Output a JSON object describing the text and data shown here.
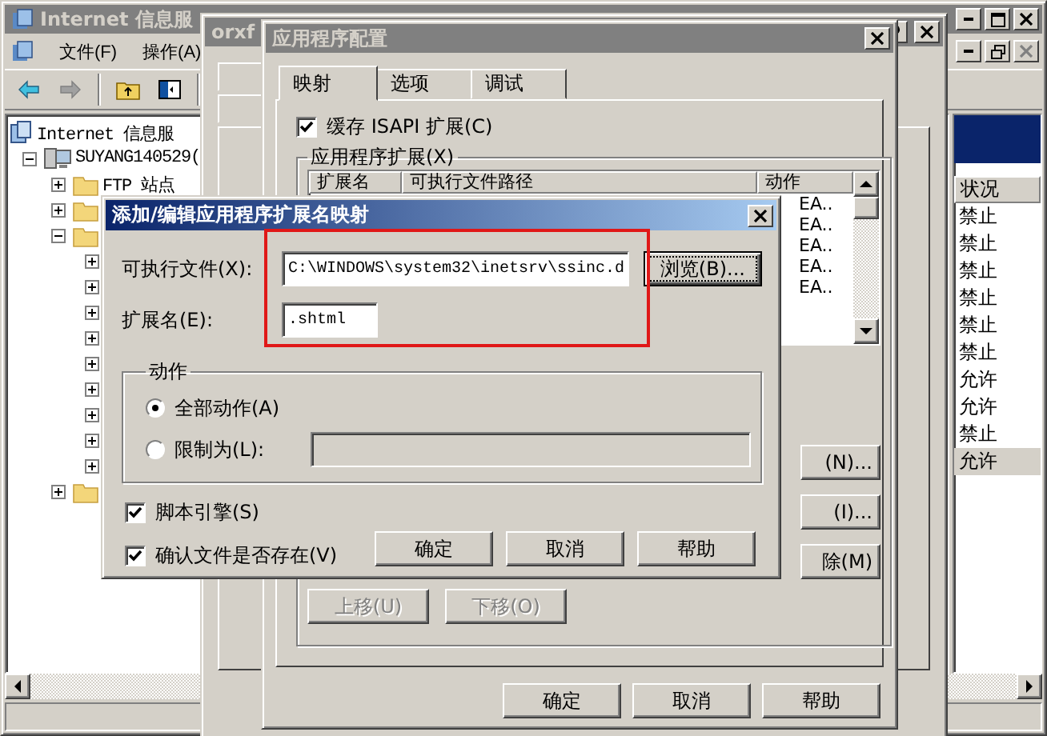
{
  "main_window": {
    "title": "Internet 信息服",
    "menu": [
      "文件(F)",
      "操作(A)"
    ],
    "toolbar": [
      {
        "kind": "back",
        "disabled": false
      },
      {
        "kind": "forward",
        "disabled": true
      },
      {
        "kind": "up",
        "disabled": false
      },
      {
        "kind": "tree",
        "disabled": false
      }
    ],
    "tree": [
      {
        "label": "Internet 信息服",
        "kind": "iis",
        "children": [
          {
            "label": "SUYANG140529(",
            "kind": "server",
            "expanded": true,
            "children": [
              {
                "label": "FTP 站点",
                "kind": "folder",
                "expanded": false
              },
              {
                "kind": "folder",
                "expanded": false
              },
              {
                "kind": "folder",
                "expanded": true,
                "children": [
                  {
                    "expanded": false
                  },
                  {
                    "expanded": false
                  },
                  {
                    "expanded": false
                  },
                  {
                    "expanded": false
                  },
                  {
                    "expanded": false
                  },
                  {
                    "expanded": false
                  },
                  {
                    "expanded": false
                  },
                  {
                    "expanded": false
                  },
                  {
                    "expanded": false
                  }
                ]
              },
              {
                "kind": "folder",
                "expanded": false
              }
            ]
          }
        ]
      }
    ],
    "status_column": {
      "header": "状况",
      "rows": [
        {
          "text": "禁止",
          "selected": false
        },
        {
          "text": "禁止",
          "selected": false
        },
        {
          "text": "禁止",
          "selected": false
        },
        {
          "text": "禁止",
          "selected": false
        },
        {
          "text": "禁止",
          "selected": false
        },
        {
          "text": "禁止",
          "selected": false
        },
        {
          "text": "允许",
          "selected": false
        },
        {
          "text": "允许",
          "selected": false
        },
        {
          "text": "禁止",
          "selected": false
        },
        {
          "text": "允许",
          "selected": true
        }
      ]
    }
  },
  "properties_dialog": {
    "title": "orxf"
  },
  "app_config_dialog": {
    "title": "应用程序配置",
    "tabs": [
      {
        "label": "映射",
        "selected": true
      },
      {
        "label": "选项",
        "selected": false
      },
      {
        "label": "调试",
        "selected": false
      }
    ],
    "cache_isapi": {
      "label": "缓存 ISAPI 扩展(C)",
      "checked": true
    },
    "extensions_group": {
      "label": "应用程序扩展(X)",
      "columns": [
        "扩展名",
        "可执行文件路径",
        "动作"
      ],
      "rows": [
        "EA..",
        "EA..",
        "EA..",
        "EA..",
        "EA.."
      ]
    },
    "side_buttons": [
      "(N)...",
      "(I)...",
      "除(M)"
    ],
    "move_buttons": [
      {
        "label": "上移(U)",
        "disabled": true
      },
      {
        "label": "下移(O)",
        "disabled": true
      }
    ],
    "buttons": [
      "确定",
      "取消",
      "帮助"
    ]
  },
  "mapping_dialog": {
    "title": "添加/编辑应用程序扩展名映射",
    "executable": {
      "label": "可执行文件(X):",
      "value": "C:\\WINDOWS\\system32\\inetsrv\\ssinc.d"
    },
    "browse_button": "浏览(B)...",
    "extension": {
      "label": "扩展名(E):",
      "value": ".shtml"
    },
    "verbs_group": {
      "label": "动作",
      "options": [
        {
          "label": "全部动作(A)",
          "selected": true
        },
        {
          "label": "限制为(L):",
          "selected": false
        }
      ]
    },
    "checkboxes": [
      {
        "label": "脚本引擎(S)",
        "checked": true
      },
      {
        "label": "确认文件是否存在(V)",
        "checked": true
      }
    ],
    "buttons": [
      "确定",
      "取消",
      "帮助"
    ]
  }
}
